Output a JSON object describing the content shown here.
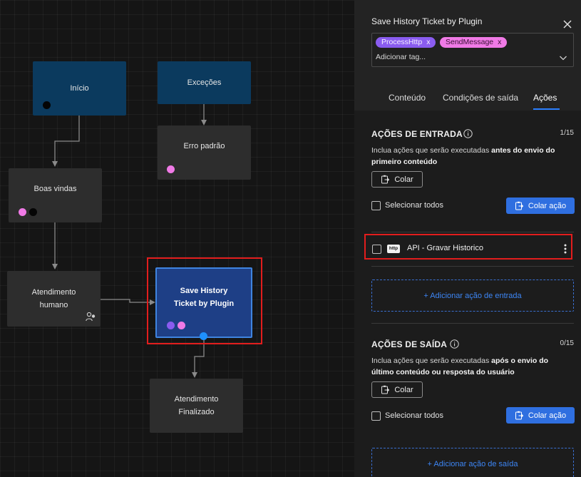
{
  "canvas": {
    "nodes": {
      "inicio": "Início",
      "excecoes": "Exceções",
      "erro_padrao": "Erro padrão",
      "boas_vindas": "Boas vindas",
      "atendimento_humano_1": "Atendimento",
      "atendimento_humano_2": "humano",
      "save_history_1": "Save History",
      "save_history_2": "Ticket by Plugin",
      "atendimento_finalizado_1": "Atendimento",
      "atendimento_finalizado_2": "Finalizado"
    }
  },
  "panel": {
    "title": "Save History Ticket by Plugin",
    "tags": [
      {
        "label": "ProcessHttp",
        "remove": "x",
        "color": "#8a5cf0"
      },
      {
        "label": "SendMessage",
        "remove": "x",
        "color": "#f07ae6"
      }
    ],
    "tag_input_placeholder": "Adicionar tag...",
    "tabs": [
      "Conteúdo",
      "Condições de saída",
      "Ações"
    ],
    "active_tab": "Ações",
    "entry": {
      "title": "AÇÕES DE ENTRADA",
      "counter": "1/15",
      "desc_prefix": "Inclua ações que serão executadas ",
      "desc_bold": "antes do envio do primeiro conteúdo",
      "paste_button": "Colar",
      "select_all": "Selecionar todos",
      "paste_action_button": "Colar ação",
      "actions": [
        {
          "badge": "http",
          "label": "API - Gravar Historico"
        }
      ],
      "add_action": "+ Adicionar ação de entrada"
    },
    "exit": {
      "title": "AÇÕES DE SAÍDA",
      "counter": "0/15",
      "desc_prefix": "Inclua ações que serão executadas ",
      "desc_bold": "após o envio do último conteúdo ou resposta do usuário",
      "paste_button": "Colar",
      "select_all": "Selecionar todos",
      "paste_action_button": "Colar ação",
      "add_action": "+ Adicionar ação de saída"
    }
  },
  "colors": {
    "accent": "#2b7fff",
    "highlight": "#e21d1d",
    "selected_node": "#1e3f86",
    "start_node": "#0b3a5e"
  }
}
